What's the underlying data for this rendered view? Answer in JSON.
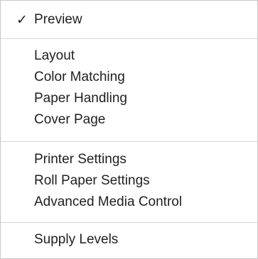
{
  "menu": {
    "items": [
      {
        "label": "Preview",
        "checked": true
      },
      {
        "label": "Layout"
      },
      {
        "label": "Color Matching"
      },
      {
        "label": "Paper Handling"
      },
      {
        "label": "Cover Page"
      },
      {
        "label": "Printer Settings"
      },
      {
        "label": "Roll Paper Settings"
      },
      {
        "label": "Advanced Media Control"
      },
      {
        "label": "Supply Levels"
      }
    ],
    "check_glyph": "✓"
  }
}
